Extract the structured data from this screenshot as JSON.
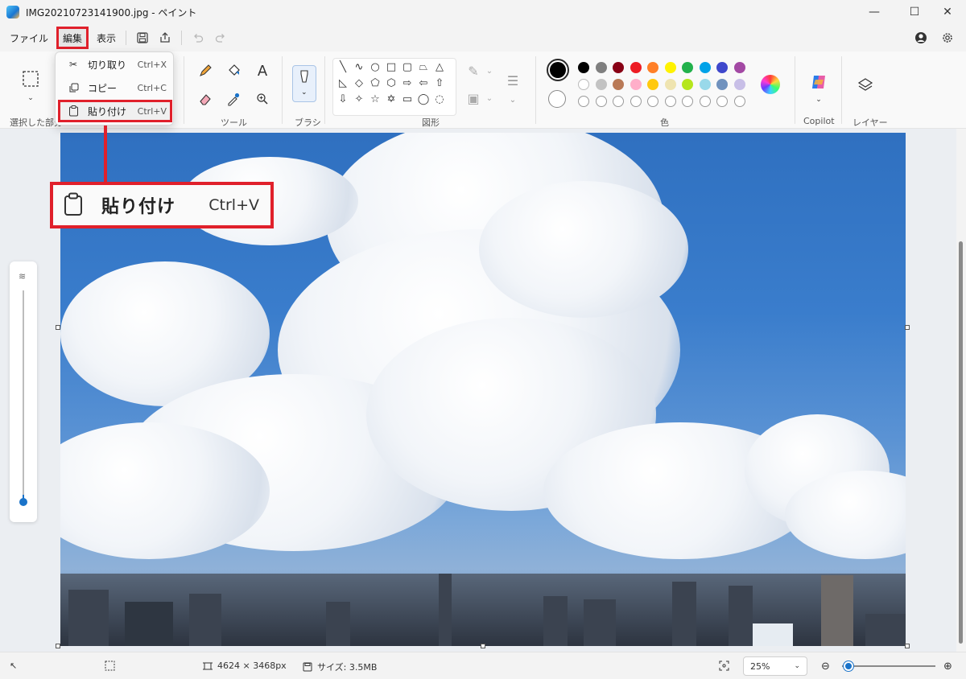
{
  "window": {
    "title": "IMG20210723141900.jpg - ペイント",
    "minimize_glyph": "—",
    "maximize_glyph": "☐",
    "close_glyph": "✕"
  },
  "menubar": {
    "file": "ファイル",
    "edit": "編集",
    "view": "表示"
  },
  "edit_menu": {
    "items": [
      {
        "label": "切り取り",
        "shortcut": "Ctrl+X",
        "icon": "scissors-icon"
      },
      {
        "label": "コピー",
        "shortcut": "Ctrl+C",
        "icon": "copy-icon"
      },
      {
        "label": "貼り付け",
        "shortcut": "Ctrl+V",
        "icon": "paste-icon"
      }
    ]
  },
  "callout": {
    "label": "貼り付け",
    "shortcut": "Ctrl+V"
  },
  "ribbon": {
    "selection_label": "選択した部分",
    "tools_label": "ツール",
    "brush_label": "ブラシ",
    "shapes_label": "図形",
    "colors_label": "色",
    "copilot_label": "Copilot",
    "layers_label": "レイヤー",
    "text_tool_glyph": "A"
  },
  "colors": {
    "row1": [
      "#000000",
      "#7f7f7f",
      "#880015",
      "#ed1c24",
      "#ff7f27",
      "#fff200",
      "#22b14c",
      "#00a2e8",
      "#3f48cc",
      "#a349a4"
    ],
    "row2": [
      "#ffffff",
      "#c3c3c3",
      "#b97a57",
      "#ffaec9",
      "#ffc90e",
      "#efe4b0",
      "#b5e61d",
      "#99d9ea",
      "#7092be",
      "#c8bfe7"
    ],
    "primary": "#000000",
    "secondary": "#ffffff"
  },
  "status": {
    "dimensions": "4624 × 3468px",
    "size": "サイズ: 3.5MB",
    "zoom": "25%"
  },
  "accent": "#1a73c9",
  "highlight": "#e0202b"
}
